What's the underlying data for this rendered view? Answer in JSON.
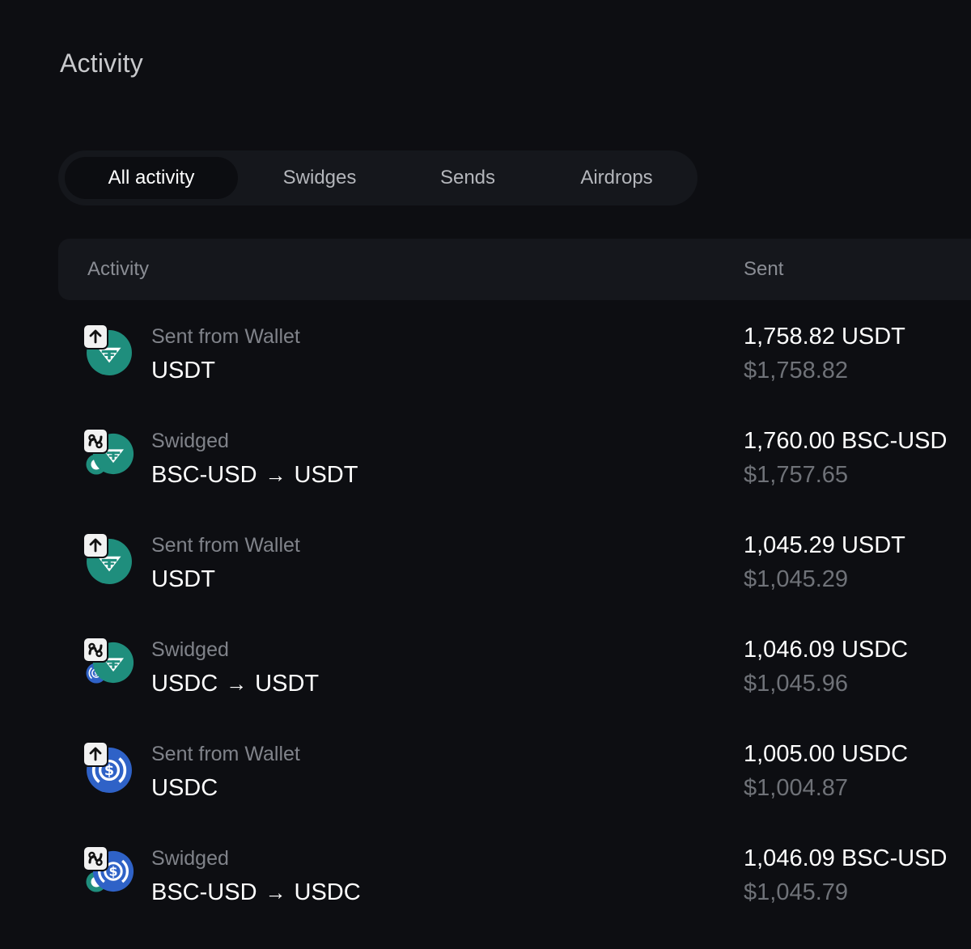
{
  "page": {
    "title": "Activity"
  },
  "tabs": [
    {
      "label": "All activity",
      "active": true
    },
    {
      "label": "Swidges",
      "active": false
    },
    {
      "label": "Sends",
      "active": false
    },
    {
      "label": "Airdrops",
      "active": false
    }
  ],
  "table": {
    "headers": {
      "activity": "Activity",
      "sent": "Sent"
    },
    "rows": [
      {
        "type": "send",
        "badge_icon": "upload-arrow-icon",
        "coin_icon": "usdt-icon",
        "label": "Sent from Wallet",
        "from": "USDT",
        "to": "",
        "amount": "1,758.82 USDT",
        "usd": "$1,758.82"
      },
      {
        "type": "swidge",
        "badge_icon": "swidge-icon",
        "coin_icon": "usdt-icon",
        "from_icon": "bsc-usd-icon",
        "label": "Swidged",
        "from": "BSC-USD",
        "to": "USDT",
        "amount": "1,760.00 BSC-USD",
        "usd": "$1,757.65"
      },
      {
        "type": "send",
        "badge_icon": "upload-arrow-icon",
        "coin_icon": "usdt-icon",
        "label": "Sent from Wallet",
        "from": "USDT",
        "to": "",
        "amount": "1,045.29 USDT",
        "usd": "$1,045.29"
      },
      {
        "type": "swidge",
        "badge_icon": "swidge-icon",
        "coin_icon": "usdt-icon",
        "from_icon": "usdc-icon",
        "label": "Swidged",
        "from": "USDC",
        "to": "USDT",
        "amount": "1,046.09 USDC",
        "usd": "$1,045.96"
      },
      {
        "type": "send",
        "badge_icon": "upload-arrow-icon",
        "coin_icon": "usdc-icon",
        "label": "Sent from Wallet",
        "from": "USDC",
        "to": "",
        "amount": "1,005.00 USDC",
        "usd": "$1,004.87"
      },
      {
        "type": "swidge",
        "badge_icon": "swidge-icon",
        "coin_icon": "usdc-icon",
        "from_icon": "bsc-usd-icon",
        "label": "Swidged",
        "from": "BSC-USD",
        "to": "USDC",
        "amount": "1,046.09 BSC-USD",
        "usd": "$1,045.79"
      }
    ]
  },
  "colors": {
    "background": "#0d0e12",
    "panel": "#15171c",
    "usdt": "#1f8e7d",
    "usdc": "#2f62c7",
    "muted_text": "#80838a"
  }
}
